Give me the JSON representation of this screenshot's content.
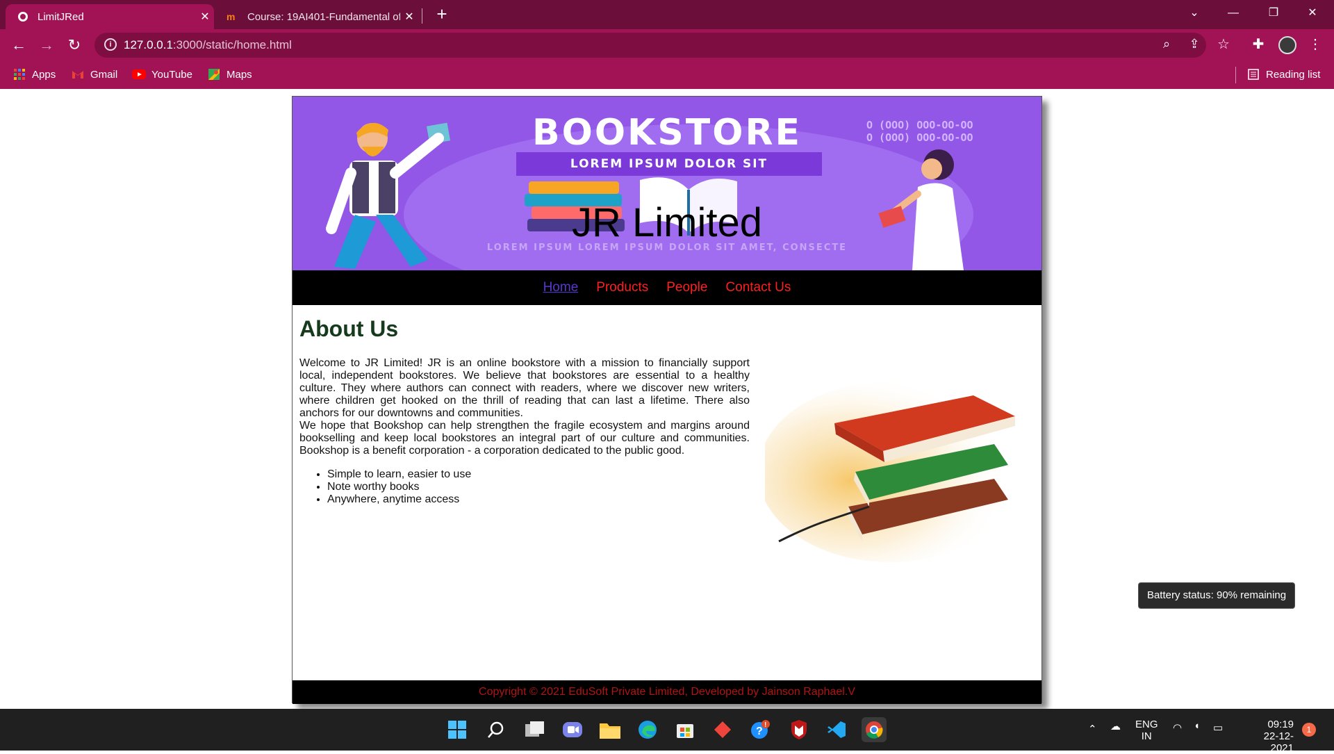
{
  "browser": {
    "tabs": [
      {
        "title": "LimitJRed",
        "active": true
      },
      {
        "title": "Course: 19AI401-Fundamental of",
        "active": false
      }
    ],
    "new_tab": "+",
    "url_host": "127.0.0.1",
    "url_path": ":3000/static/home.html",
    "bookmarks": [
      "Apps",
      "Gmail",
      "YouTube",
      "Maps"
    ],
    "reading_list": "Reading list",
    "colors": {
      "titlebar": "#6b0f3a",
      "toolbar": "#a11355"
    }
  },
  "site": {
    "banner": {
      "store_name": "BOOKSTORE",
      "tagline": "LOREM IPSUM DOLOR SIT",
      "phones": [
        "O (OOO) OOO-OO-OO",
        "O (OOO) OOO-OO-OO"
      ],
      "bottom_text": "LOREM IPSUM LOREM IPSUM DOLOR SIT AMET, CONSECTE",
      "headline": "JR Limited"
    },
    "nav": [
      {
        "label": "Home",
        "current": true
      },
      {
        "label": "Products",
        "current": false
      },
      {
        "label": "People",
        "current": false
      },
      {
        "label": "Contact Us",
        "current": false
      }
    ],
    "about": {
      "heading": "About Us",
      "paragraph1": "Welcome to JR Limited! JR is an online bookstore with a mission to financially support local, independent bookstores. We believe that bookstores are essential to a healthy culture. They where authors can connect with readers, where we discover new writers, where children get hooked on the thrill of reading that can last a lifetime. There also anchors for our downtowns and communities.",
      "paragraph2": "We hope that Bookshop can help strengthen the fragile ecosystem and margins around bookselling and keep local bookstores an integral part of our culture and communities. Bookshop is a benefit corporation - a corporation dedicated to the public good.",
      "features": [
        "Simple to learn, easier to use",
        "Note worthy books",
        "Anywhere, anytime access"
      ]
    },
    "footer": "Copyright © 2021 EduSoft Private Limited, Developed by Jainson Raphael.V"
  },
  "tooltip": "Battery status: 90% remaining",
  "taskbar": {
    "language": "ENG",
    "region": "IN",
    "time": "09:19",
    "date": "22-12-2021",
    "notification_count": "1"
  }
}
